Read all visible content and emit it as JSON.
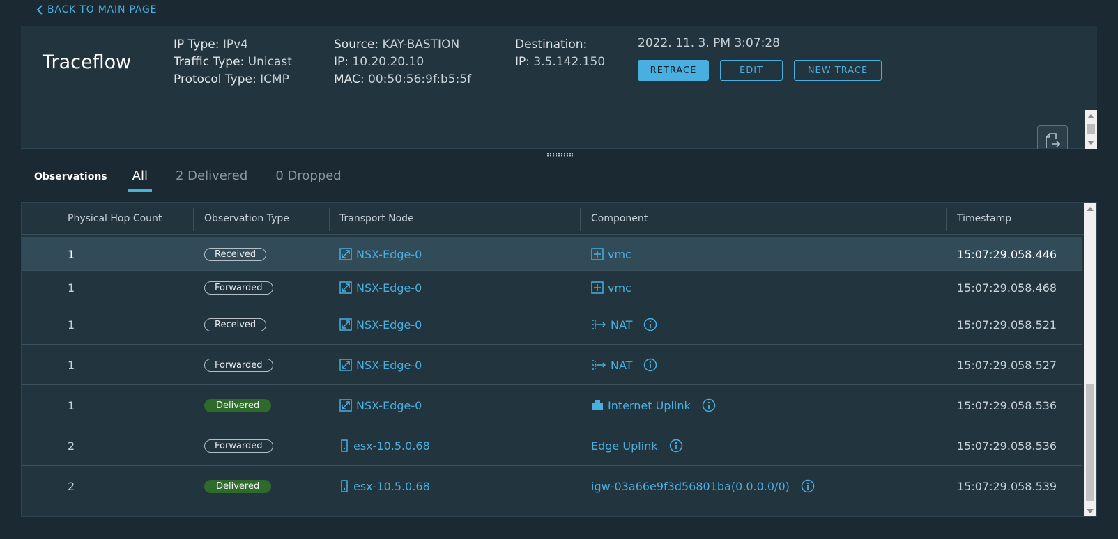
{
  "nav": {
    "back_label": "BACK TO MAIN PAGE"
  },
  "header": {
    "title": "Traceflow",
    "ip_type": {
      "label": "IP Type:",
      "value": "IPv4"
    },
    "traffic_type": {
      "label": "Traffic Type:",
      "value": "Unicast"
    },
    "protocol_type": {
      "label": "Protocol Type:",
      "value": "ICMP"
    },
    "source": {
      "label": "Source:",
      "value": "KAY-BASTION"
    },
    "source_ip": {
      "label": "IP:",
      "value": "10.20.20.10"
    },
    "source_mac": {
      "label": "MAC:",
      "value": "00:50:56:9f:b5:5f"
    },
    "destination": {
      "label": "Destination:"
    },
    "dest_ip": {
      "label": "IP:",
      "value": "3.5.142.150"
    },
    "timestamp": "2022. 11. 3. PM 3:07:28",
    "buttons": {
      "retrace": "RETRACE",
      "edit": "EDIT",
      "new_trace": "NEW TRACE"
    }
  },
  "observations": {
    "heading": "Observations",
    "tabs": [
      "All",
      "2 Delivered",
      "0 Dropped"
    ],
    "active_tab": "All",
    "columns": [
      "Physical Hop Count",
      "Observation Type",
      "Transport Node",
      "Component",
      "Timestamp"
    ],
    "rows": [
      {
        "hop": "1",
        "type": "Received",
        "node": "NSX-Edge-0",
        "node_icon": "edge-icon",
        "component": "vmc",
        "component_icon": "router-icon",
        "info": false,
        "timestamp": "15:07:29.058.446",
        "selected": true
      },
      {
        "hop": "1",
        "type": "Forwarded",
        "node": "NSX-Edge-0",
        "node_icon": "edge-icon",
        "component": "vmc",
        "component_icon": "router-icon",
        "info": false,
        "timestamp": "15:07:29.058.468",
        "selected": false
      },
      {
        "hop": "1",
        "type": "Received",
        "node": "NSX-Edge-0",
        "node_icon": "edge-icon",
        "component": "NAT",
        "component_icon": "nat-icon",
        "info": true,
        "timestamp": "15:07:29.058.521",
        "selected": false
      },
      {
        "hop": "1",
        "type": "Forwarded",
        "node": "NSX-Edge-0",
        "node_icon": "edge-icon",
        "component": "NAT",
        "component_icon": "nat-icon",
        "info": true,
        "timestamp": "15:07:29.058.527",
        "selected": false
      },
      {
        "hop": "1",
        "type": "Delivered",
        "node": "NSX-Edge-0",
        "node_icon": "edge-icon",
        "component": "Internet Uplink",
        "component_icon": "uplink-icon",
        "info": true,
        "timestamp": "15:07:29.058.536",
        "selected": false
      },
      {
        "hop": "2",
        "type": "Forwarded",
        "node": "esx-10.5.0.68",
        "node_icon": "host-icon",
        "component": "Edge Uplink",
        "component_icon": "",
        "info": true,
        "timestamp": "15:07:29.058.536",
        "selected": false
      },
      {
        "hop": "2",
        "type": "Delivered",
        "node": "esx-10.5.0.68",
        "node_icon": "host-icon",
        "component": "igw-03a66e9f3d56801ba(0.0.0.0/0)",
        "component_icon": "",
        "info": true,
        "timestamp": "15:07:29.058.539",
        "selected": false
      }
    ]
  },
  "colors": {
    "accent": "#49aee0",
    "delivered": "#2f6a2d",
    "selected_row": "#324b59"
  }
}
